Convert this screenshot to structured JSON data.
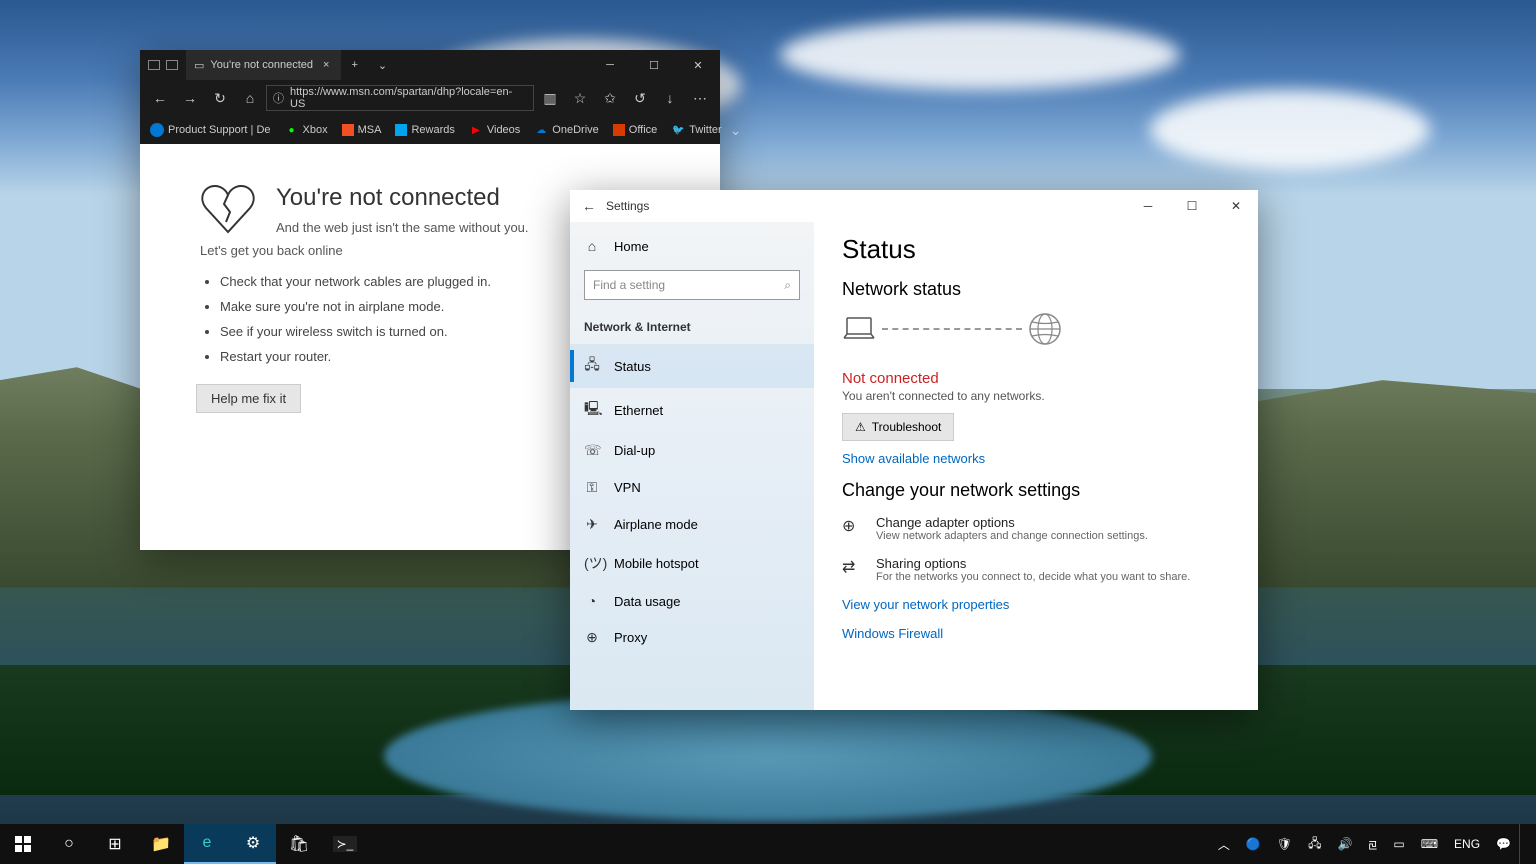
{
  "edge": {
    "tabTitle": "You're not connected",
    "url": "https://www.msn.com/spartan/dhp?locale=en-US",
    "favorites": [
      "Product Support | De",
      "Xbox",
      "MSA",
      "Rewards",
      "Videos",
      "OneDrive",
      "Office",
      "Twitter"
    ],
    "page": {
      "heading": "You're not connected",
      "sub1": "And the web just isn't the same without you.",
      "sub2": "Let's get you back online",
      "tips": [
        "Check that your network cables are plugged in.",
        "Make sure you're not in airplane mode.",
        "See if your wireless switch is turned on.",
        "Restart your router."
      ],
      "button": "Help me fix it"
    }
  },
  "settings": {
    "appName": "Settings",
    "home": "Home",
    "searchPlaceholder": "Find a setting",
    "section": "Network & Internet",
    "navItems": [
      "Status",
      "Ethernet",
      "Dial-up",
      "VPN",
      "Airplane mode",
      "Mobile hotspot",
      "Data usage",
      "Proxy"
    ],
    "main": {
      "title": "Status",
      "subtitle": "Network status",
      "notConnected": "Not connected",
      "notConnectedSub": "You aren't connected to any networks.",
      "troubleshoot": "Troubleshoot",
      "showNetworks": "Show available networks",
      "changeHeading": "Change your network settings",
      "options": [
        {
          "title": "Change adapter options",
          "sub": "View network adapters and change connection settings."
        },
        {
          "title": "Sharing options",
          "sub": "For the networks you connect to, decide what you want to share."
        }
      ],
      "links": [
        "View your network properties",
        "Windows Firewall"
      ]
    }
  },
  "taskbar": {
    "lang": "ENG"
  }
}
